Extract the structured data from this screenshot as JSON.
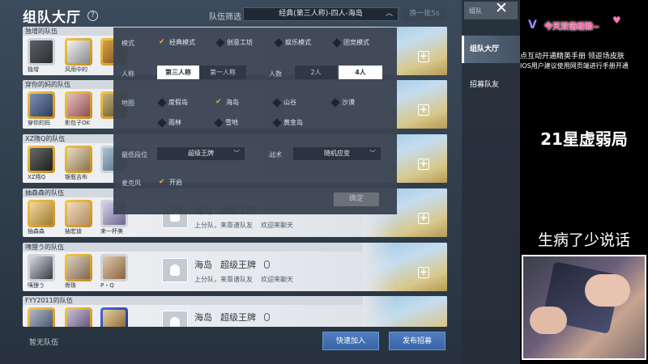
{
  "header": {
    "title": "组队大厅",
    "filter_label": "队伍筛选",
    "filter_value": "经典(第三人称)-四人-海岛",
    "refresh_label": "换一批5s"
  },
  "teams": [
    {
      "name": "独增的队伍",
      "members": [
        "独增",
        "风雨中的",
        ""
      ],
      "info": null
    },
    {
      "name": "穿你的妈的队伍",
      "members": [
        "穿你的妈",
        "影包子OK",
        ""
      ],
      "info": null
    },
    {
      "name": "XZ隋Q的队伍",
      "members": [
        "XZ隋Q",
        "银瓶吉布",
        ""
      ],
      "info": null
    },
    {
      "name": "抽森森的队伍",
      "members": [
        "抽森森",
        "抽宏迪",
        "来一杯美"
      ],
      "info": {
        "map": "海岛",
        "rank": "超级王牌",
        "rank_tag": "上分队，来靠谱队友",
        "welcome": "欢迎来聊天"
      }
    },
    {
      "name": "咦狸う的队伍",
      "members": [
        "咦狸う",
        "骨珠",
        "P・Q"
      ],
      "info": {
        "map": "海岛",
        "rank": "超级王牌",
        "rank_tag": "上分队，来靠谱队友",
        "welcome": "欢迎来聊天"
      }
    },
    {
      "name": "FYY2011的队伍",
      "members": [
        "",
        "",
        ""
      ],
      "info": {
        "map": "海岛",
        "rank": "超级王牌",
        "rank_tag": "",
        "welcome": ""
      }
    }
  ],
  "filter_panel": {
    "mode_label": "模式",
    "modes": [
      {
        "label": "经典模式",
        "checked": true
      },
      {
        "label": "创意工坊",
        "checked": false
      },
      {
        "label": "娱乐模式",
        "checked": false
      },
      {
        "label": "团竞模式",
        "checked": false
      }
    ],
    "perspective_label": "人称",
    "perspectives": [
      {
        "label": "第三人称",
        "active": true
      },
      {
        "label": "第一人称",
        "active": false
      }
    ],
    "size_label": "人数",
    "sizes": [
      {
        "label": "2人",
        "active": false
      },
      {
        "label": "4人",
        "active": true
      }
    ],
    "map_label": "地图",
    "maps": [
      {
        "label": "度假岛",
        "checked": false
      },
      {
        "label": "海岛",
        "checked": true
      },
      {
        "label": "山谷",
        "checked": false
      },
      {
        "label": "沙漠",
        "checked": false
      },
      {
        "label": "雨林",
        "checked": false
      },
      {
        "label": "雪地",
        "checked": false
      },
      {
        "label": "黄金岛",
        "checked": false
      }
    ],
    "min_rank_label": "最低段位",
    "min_rank_value": "超级王牌",
    "tactic_label": "战术",
    "tactic_value": "随机应变",
    "mic_label": "麦克风",
    "mic_option": {
      "label": "开启",
      "checked": true
    },
    "confirm_label": "确定"
  },
  "bottom": {
    "no_team": "暂无队伍",
    "quick_join": "快速加入",
    "post_recruit": "发布招募"
  },
  "right_nav": {
    "top_label": "组队",
    "items": [
      {
        "label": "组队大厅",
        "active": true
      },
      {
        "label": "招募队友",
        "active": false
      }
    ]
  },
  "stream_overlay": {
    "banner": "今天双倍经验~",
    "ticker1": "点互动开通精英手册 领返场皮肤",
    "ticker2": "IOS用户建议使用网页端进行手册开通",
    "big_line1": "21星虚弱局",
    "big_line2": "生病了少说话"
  },
  "colors": {
    "accent_blue": "#3f6fb5",
    "check_gold": "#f0b12b",
    "banner_pink": "#ff4f9a"
  }
}
